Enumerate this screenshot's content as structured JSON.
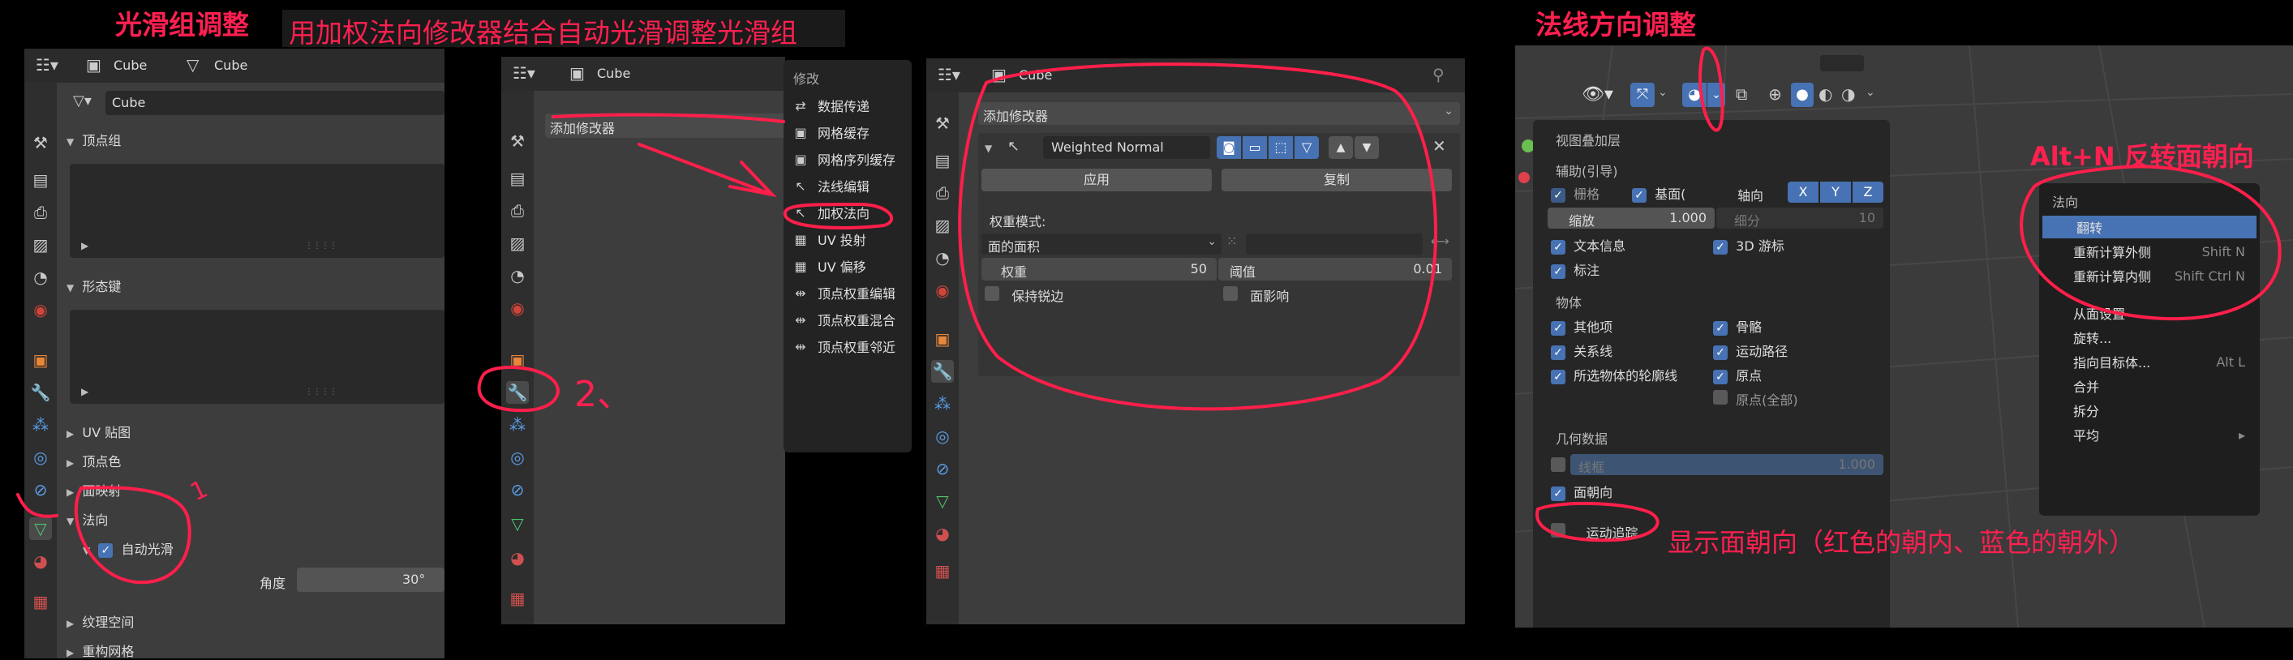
{
  "annotations": {
    "title1": "光滑组调整",
    "title2": "用加权法向修改器结合自动光滑调整光滑组",
    "title3": "法线方向调整",
    "step1": "1",
    "step2": "2、",
    "alt_n": "Alt+N 反转面朝向",
    "face_orient_note": "显示面朝向（红色的朝内、蓝色的朝外）"
  },
  "panel1": {
    "header_object": "Cube",
    "header_mesh": "Cube",
    "mesh_name": "Cube",
    "sections": {
      "vertex_groups": "顶点组",
      "shape_keys": "形态键",
      "uv_maps": "UV 贴图",
      "vertex_colors": "顶点色",
      "face_maps": "面映射",
      "normals": "法向",
      "auto_smooth": "自动光滑",
      "angle_label": "角度",
      "angle_value": "30°",
      "texture_space": "纹理空间",
      "remesh": "重构网格"
    }
  },
  "panel2": {
    "header": "Cube",
    "add_modifier": "添加修改器"
  },
  "modifier_menu": {
    "header": "修改",
    "items": [
      "数据传递",
      "网格缓存",
      "网格序列缓存",
      "法线编辑",
      "加权法向",
      "UV 投射",
      "UV 偏移",
      "顶点权重编辑",
      "顶点权重混合",
      "顶点权重邻近"
    ]
  },
  "panel3": {
    "header": "Cube",
    "add_modifier": "添加修改器",
    "modifier_name": "Weighted Normal",
    "apply": "应用",
    "copy": "复制",
    "weight_mode_label": "权重模式:",
    "weight_mode_value": "面的面积",
    "weight_label": "权重",
    "weight_value": "50",
    "threshold_label": "阈值",
    "threshold_value": "0.01",
    "keep_sharp": "保持锐边",
    "face_influence": "面影响"
  },
  "overlay": {
    "title": "视图叠加层",
    "guides": "辅助(引导)",
    "grid": "栅格",
    "floor": "基面(",
    "axis": "轴向",
    "axes": [
      "X",
      "Y",
      "Z"
    ],
    "scale_label": "缩放",
    "scale_value": "1.000",
    "subdiv_label": "细分",
    "subdiv_value": "10",
    "text_info": "文本信息",
    "cursor3d": "3D 游标",
    "annotations_label": "标注",
    "objects": "物体",
    "extras": "其他项",
    "bones": "骨骼",
    "relations": "关系线",
    "motion_paths": "运动路径",
    "outline_selected": "所选物体的轮廓线",
    "origins": "原点",
    "origins_all": "原点(全部)",
    "geometry": "几何数据",
    "wireframe": "线框",
    "wireframe_value": "1.000",
    "face_orientation": "面朝向",
    "motion_tracking": "运动追踪"
  },
  "normals_menu": {
    "title": "法向",
    "items": [
      {
        "label": "翻转",
        "shortcut": ""
      },
      {
        "label": "重新计算外侧",
        "shortcut": "Shift N"
      },
      {
        "label": "重新计算内侧",
        "shortcut": "Shift Ctrl N"
      },
      {
        "label": "从面设置",
        "shortcut": ""
      },
      {
        "label": "旋转...",
        "shortcut": ""
      },
      {
        "label": "指向目标体...",
        "shortcut": "Alt L"
      },
      {
        "label": "合并",
        "shortcut": ""
      },
      {
        "label": "拆分",
        "shortcut": ""
      },
      {
        "label": "平均",
        "shortcut": "▸"
      }
    ]
  },
  "colors": {
    "accent": "#4772b3",
    "annotation": "#ff2050"
  }
}
